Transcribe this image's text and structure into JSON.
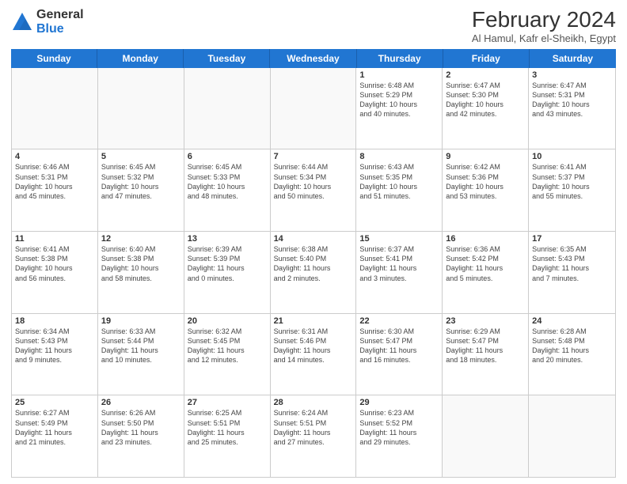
{
  "header": {
    "logo_general": "General",
    "logo_blue": "Blue",
    "month_year": "February 2024",
    "location": "Al Hamul, Kafr el-Sheikh, Egypt"
  },
  "days_of_week": [
    "Sunday",
    "Monday",
    "Tuesday",
    "Wednesday",
    "Thursday",
    "Friday",
    "Saturday"
  ],
  "weeks": [
    [
      {
        "day": "",
        "info": ""
      },
      {
        "day": "",
        "info": ""
      },
      {
        "day": "",
        "info": ""
      },
      {
        "day": "",
        "info": ""
      },
      {
        "day": "1",
        "info": "Sunrise: 6:48 AM\nSunset: 5:29 PM\nDaylight: 10 hours\nand 40 minutes."
      },
      {
        "day": "2",
        "info": "Sunrise: 6:47 AM\nSunset: 5:30 PM\nDaylight: 10 hours\nand 42 minutes."
      },
      {
        "day": "3",
        "info": "Sunrise: 6:47 AM\nSunset: 5:31 PM\nDaylight: 10 hours\nand 43 minutes."
      }
    ],
    [
      {
        "day": "4",
        "info": "Sunrise: 6:46 AM\nSunset: 5:31 PM\nDaylight: 10 hours\nand 45 minutes."
      },
      {
        "day": "5",
        "info": "Sunrise: 6:45 AM\nSunset: 5:32 PM\nDaylight: 10 hours\nand 47 minutes."
      },
      {
        "day": "6",
        "info": "Sunrise: 6:45 AM\nSunset: 5:33 PM\nDaylight: 10 hours\nand 48 minutes."
      },
      {
        "day": "7",
        "info": "Sunrise: 6:44 AM\nSunset: 5:34 PM\nDaylight: 10 hours\nand 50 minutes."
      },
      {
        "day": "8",
        "info": "Sunrise: 6:43 AM\nSunset: 5:35 PM\nDaylight: 10 hours\nand 51 minutes."
      },
      {
        "day": "9",
        "info": "Sunrise: 6:42 AM\nSunset: 5:36 PM\nDaylight: 10 hours\nand 53 minutes."
      },
      {
        "day": "10",
        "info": "Sunrise: 6:41 AM\nSunset: 5:37 PM\nDaylight: 10 hours\nand 55 minutes."
      }
    ],
    [
      {
        "day": "11",
        "info": "Sunrise: 6:41 AM\nSunset: 5:38 PM\nDaylight: 10 hours\nand 56 minutes."
      },
      {
        "day": "12",
        "info": "Sunrise: 6:40 AM\nSunset: 5:38 PM\nDaylight: 10 hours\nand 58 minutes."
      },
      {
        "day": "13",
        "info": "Sunrise: 6:39 AM\nSunset: 5:39 PM\nDaylight: 11 hours\nand 0 minutes."
      },
      {
        "day": "14",
        "info": "Sunrise: 6:38 AM\nSunset: 5:40 PM\nDaylight: 11 hours\nand 2 minutes."
      },
      {
        "day": "15",
        "info": "Sunrise: 6:37 AM\nSunset: 5:41 PM\nDaylight: 11 hours\nand 3 minutes."
      },
      {
        "day": "16",
        "info": "Sunrise: 6:36 AM\nSunset: 5:42 PM\nDaylight: 11 hours\nand 5 minutes."
      },
      {
        "day": "17",
        "info": "Sunrise: 6:35 AM\nSunset: 5:43 PM\nDaylight: 11 hours\nand 7 minutes."
      }
    ],
    [
      {
        "day": "18",
        "info": "Sunrise: 6:34 AM\nSunset: 5:43 PM\nDaylight: 11 hours\nand 9 minutes."
      },
      {
        "day": "19",
        "info": "Sunrise: 6:33 AM\nSunset: 5:44 PM\nDaylight: 11 hours\nand 10 minutes."
      },
      {
        "day": "20",
        "info": "Sunrise: 6:32 AM\nSunset: 5:45 PM\nDaylight: 11 hours\nand 12 minutes."
      },
      {
        "day": "21",
        "info": "Sunrise: 6:31 AM\nSunset: 5:46 PM\nDaylight: 11 hours\nand 14 minutes."
      },
      {
        "day": "22",
        "info": "Sunrise: 6:30 AM\nSunset: 5:47 PM\nDaylight: 11 hours\nand 16 minutes."
      },
      {
        "day": "23",
        "info": "Sunrise: 6:29 AM\nSunset: 5:47 PM\nDaylight: 11 hours\nand 18 minutes."
      },
      {
        "day": "24",
        "info": "Sunrise: 6:28 AM\nSunset: 5:48 PM\nDaylight: 11 hours\nand 20 minutes."
      }
    ],
    [
      {
        "day": "25",
        "info": "Sunrise: 6:27 AM\nSunset: 5:49 PM\nDaylight: 11 hours\nand 21 minutes."
      },
      {
        "day": "26",
        "info": "Sunrise: 6:26 AM\nSunset: 5:50 PM\nDaylight: 11 hours\nand 23 minutes."
      },
      {
        "day": "27",
        "info": "Sunrise: 6:25 AM\nSunset: 5:51 PM\nDaylight: 11 hours\nand 25 minutes."
      },
      {
        "day": "28",
        "info": "Sunrise: 6:24 AM\nSunset: 5:51 PM\nDaylight: 11 hours\nand 27 minutes."
      },
      {
        "day": "29",
        "info": "Sunrise: 6:23 AM\nSunset: 5:52 PM\nDaylight: 11 hours\nand 29 minutes."
      },
      {
        "day": "",
        "info": ""
      },
      {
        "day": "",
        "info": ""
      }
    ]
  ]
}
